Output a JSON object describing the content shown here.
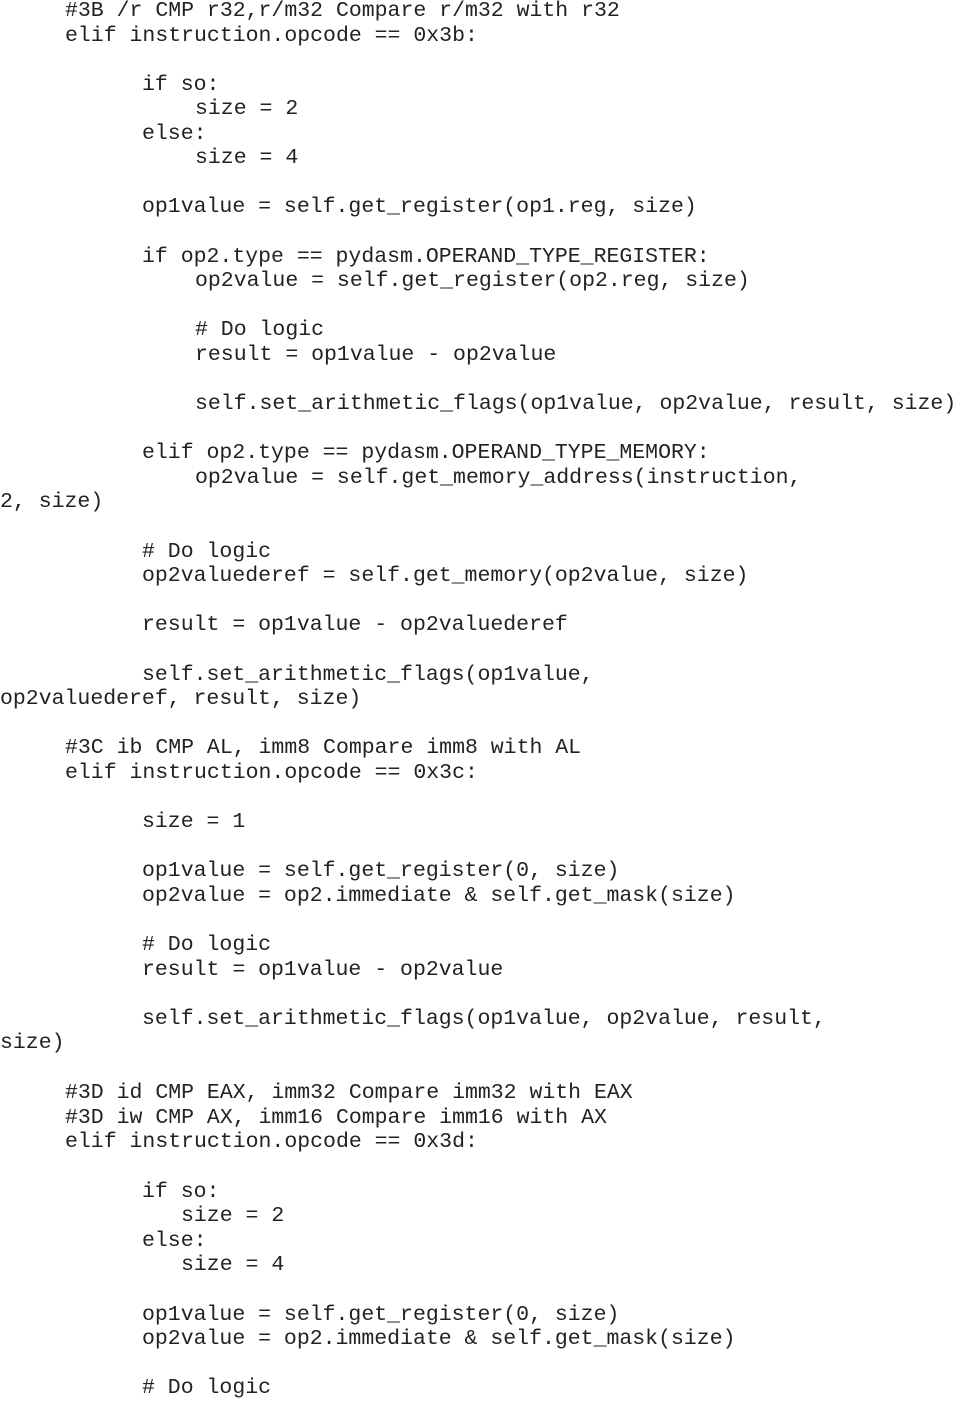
{
  "document": {
    "language": "python",
    "lines": [
      "#3B /r CMP r32,r/m32 Compare r/m32 with r32",
      "elif instruction.opcode == 0x3b:",
      "if so:",
      "size = 2",
      "else:",
      "size = 4",
      "op1value = self.get_register(op1.reg, size)",
      "if op2.type == pydasm.OPERAND_TYPE_REGISTER:",
      "op2value = self.get_register(op2.reg, size)",
      "# Do logic",
      "result = op1value - op2value",
      "self.set_arithmetic_flags(op1value, op2value, result, size)",
      "elif op2.type == pydasm.OPERAND_TYPE_MEMORY:",
      "op2value = self.get_memory_address(instruction,",
      "2, size)",
      "# Do logic",
      "op2valuederef = self.get_memory(op2value, size)",
      "result = op1value - op2valuederef",
      "self.set_arithmetic_flags(op1value,",
      "op2valuederef, result, size)",
      "#3C ib CMP AL, imm8 Compare imm8 with AL",
      "elif instruction.opcode == 0x3c:",
      "size = 1",
      "op1value = self.get_register(0, size)",
      "op2value = op2.immediate & self.get_mask(size)",
      "# Do logic",
      "result = op1value - op2value",
      "self.set_arithmetic_flags(op1value, op2value, result,",
      "size)",
      "#3D id CMP EAX, imm32 Compare imm32 with EAX",
      "#3D iw CMP AX, imm16 Compare imm16 with AX",
      "elif instruction.opcode == 0x3d:",
      "if so:",
      "size = 2",
      "else:",
      "size = 4",
      "op1value = self.get_register(0, size)",
      "op2value = op2.immediate & self.get_mask(size)",
      "# Do logic"
    ]
  }
}
